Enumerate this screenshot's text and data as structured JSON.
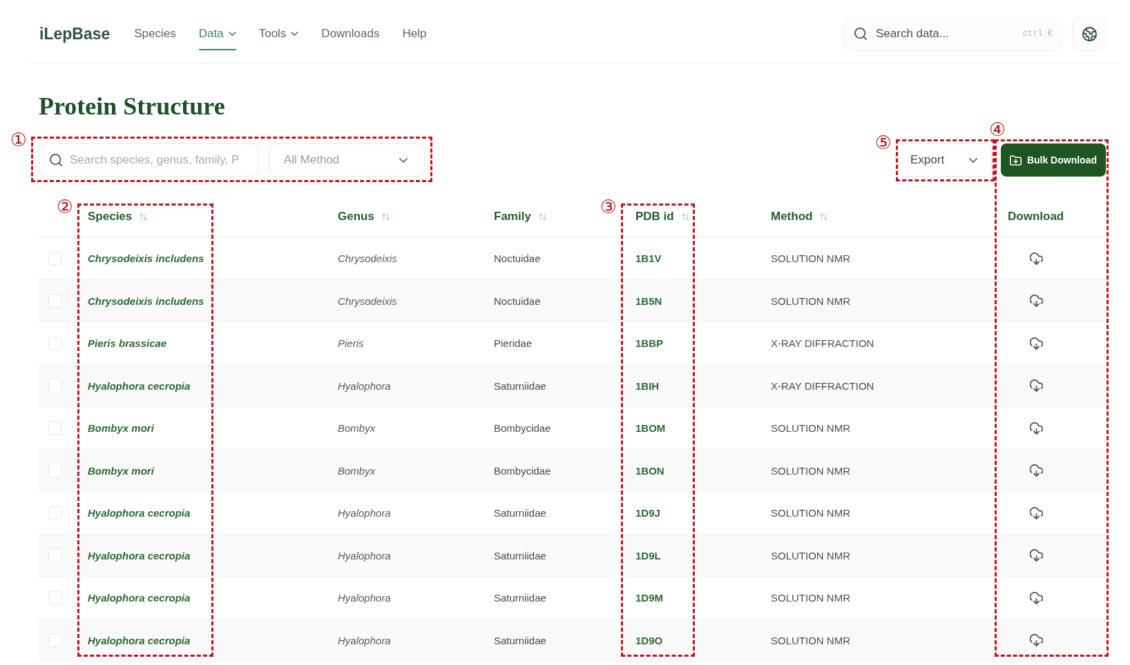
{
  "header": {
    "logo": "iLepBase",
    "nav": [
      {
        "label": "Species",
        "selected": false,
        "dropdown": false
      },
      {
        "label": "Data",
        "selected": true,
        "dropdown": true
      },
      {
        "label": "Tools",
        "selected": false,
        "dropdown": true
      },
      {
        "label": "Downloads",
        "selected": false,
        "dropdown": false
      },
      {
        "label": "Help",
        "selected": false,
        "dropdown": false
      }
    ],
    "search": {
      "placeholder": "Search data...",
      "shortcut": "ctrl K"
    }
  },
  "page": {
    "title": "Protein Structure"
  },
  "toolbar": {
    "filters": {
      "search": {
        "placeholder": "Search species, genus, family, P"
      },
      "method_select": {
        "value": "All Method"
      },
      "callout": {
        "label": "①"
      }
    },
    "export": {
      "label": "Export",
      "callout": {
        "label": "⑤"
      }
    },
    "bulk_download": {
      "label": "Bulk Download"
    }
  },
  "table": {
    "columns": [
      {
        "label": "Species",
        "sortable": true,
        "callout": {
          "label": "②",
          "includes_toolbar": false
        }
      },
      {
        "label": "Genus",
        "sortable": true
      },
      {
        "label": "Family",
        "sortable": true
      },
      {
        "label": "PDB id",
        "sortable": true,
        "callout": {
          "label": "③",
          "includes_toolbar": false
        }
      },
      {
        "label": "Method",
        "sortable": true
      },
      {
        "label": "Download",
        "sortable": false,
        "callout": {
          "label": "④",
          "includes_toolbar": true
        }
      }
    ],
    "rows": [
      {
        "checked": false,
        "species": "Chrysodeixis includens",
        "genus": "Chrysodeixis",
        "family": "Noctuidae",
        "pdb_id": "1B1V",
        "method": "SOLUTION NMR"
      },
      {
        "checked": false,
        "species": "Chrysodeixis includens",
        "genus": "Chrysodeixis",
        "family": "Noctuidae",
        "pdb_id": "1B5N",
        "method": "SOLUTION NMR"
      },
      {
        "checked": false,
        "species": "Pieris brassicae",
        "genus": "Pieris",
        "family": "Pieridae",
        "pdb_id": "1BBP",
        "method": "X-RAY DIFFRACTION"
      },
      {
        "checked": false,
        "species": "Hyalophora cecropia",
        "genus": "Hyalophora",
        "family": "Saturniidae",
        "pdb_id": "1BIH",
        "method": "X-RAY DIFFRACTION"
      },
      {
        "checked": false,
        "species": "Bombyx mori",
        "genus": "Bombyx",
        "family": "Bombycidae",
        "pdb_id": "1BOM",
        "method": "SOLUTION NMR"
      },
      {
        "checked": false,
        "species": "Bombyx mori",
        "genus": "Bombyx",
        "family": "Bombycidae",
        "pdb_id": "1BON",
        "method": "SOLUTION NMR"
      },
      {
        "checked": false,
        "species": "Hyalophora cecropia",
        "genus": "Hyalophora",
        "family": "Saturniidae",
        "pdb_id": "1D9J",
        "method": "SOLUTION NMR"
      },
      {
        "checked": false,
        "species": "Hyalophora cecropia",
        "genus": "Hyalophora",
        "family": "Saturniidae",
        "pdb_id": "1D9L",
        "method": "SOLUTION NMR"
      },
      {
        "checked": false,
        "species": "Hyalophora cecropia",
        "genus": "Hyalophora",
        "family": "Saturniidae",
        "pdb_id": "1D9M",
        "method": "SOLUTION NMR"
      },
      {
        "checked": false,
        "species": "Hyalophora cecropia",
        "genus": "Hyalophora",
        "family": "Saturniidae",
        "pdb_id": "1D9O",
        "method": "SOLUTION NMR"
      }
    ]
  }
}
